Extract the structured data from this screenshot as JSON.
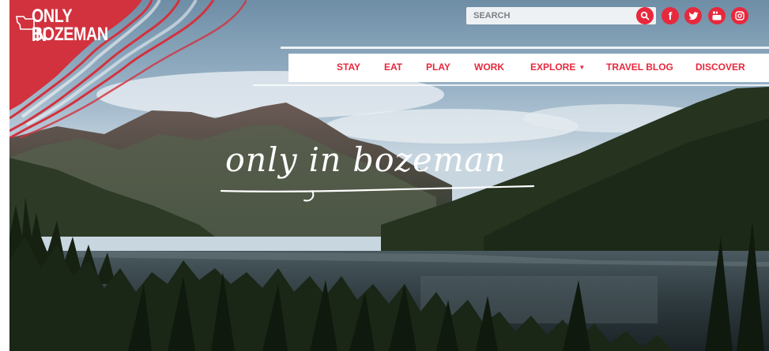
{
  "logo": {
    "line1": "ONLY IN",
    "line2": "BOZEMAN"
  },
  "search": {
    "placeholder": "SEARCH"
  },
  "social": [
    {
      "name": "search-icon"
    },
    {
      "name": "facebook-icon",
      "glyph": "f"
    },
    {
      "name": "twitter-icon"
    },
    {
      "name": "youtube-icon"
    },
    {
      "name": "instagram-icon"
    }
  ],
  "nav": {
    "items": [
      {
        "label": "STAY"
      },
      {
        "label": "EAT"
      },
      {
        "label": "PLAY"
      },
      {
        "label": "WORK"
      },
      {
        "label": "EXPLORE"
      },
      {
        "label": "TRAVEL BLOG"
      },
      {
        "label": "DISCOVER"
      }
    ]
  },
  "hero": {
    "title": "only in bozeman"
  },
  "colors": {
    "accent": "#e8283c",
    "logo_bg": "#d2323e",
    "white": "#ffffff"
  }
}
